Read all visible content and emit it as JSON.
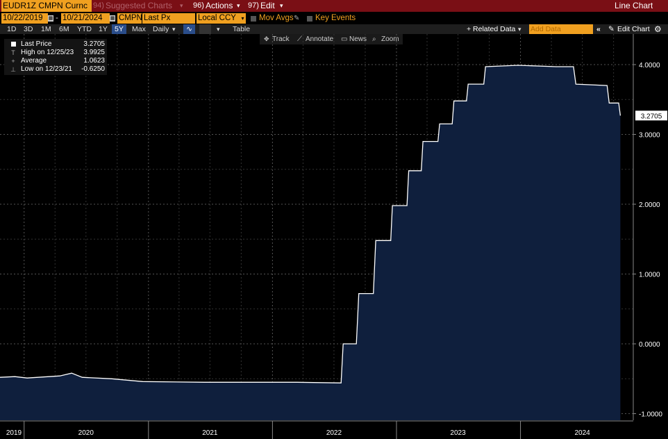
{
  "header": {
    "ticker": "EUDR1Z CMPN Curnc",
    "suggested_num": "94)",
    "suggested": "Suggested Charts",
    "actions_num": "96)",
    "actions": "Actions",
    "edit_num": "97)",
    "edit": "Edit",
    "chart_type": "Line Chart"
  },
  "controls": {
    "start_date": "10/22/2019",
    "end_date": "10/21/2024",
    "source": "CMPN",
    "field": "Last Px",
    "currency": "Local CCY",
    "mov_avgs": "Mov Avgs",
    "key_events": "Key Events"
  },
  "periods": [
    "1D",
    "3D",
    "1M",
    "6M",
    "YTD",
    "1Y",
    "5Y",
    "Max"
  ],
  "selected_period": "5Y",
  "frequency": "Daily",
  "table_label": "Table",
  "related_data": "+ Related Data",
  "add_data_placeholder": "Add Data",
  "edit_chart": "Edit Chart",
  "tools": {
    "track": "Track",
    "annotate": "Annotate",
    "news": "News",
    "zoom": "Zoom"
  },
  "legend": {
    "last_label": "Last Price",
    "last_value": "3.2705",
    "high_label": "High on 12/25/23",
    "high_value": "3.9925",
    "avg_label": "Average",
    "avg_value": "1.0623",
    "low_label": "Low on 12/23/21",
    "low_value": "-0.6250"
  },
  "colors": {
    "area_fill": "#0f1f3d",
    "line": "#ffffff",
    "header_bg": "#7a0f15",
    "accent": "#f0a020",
    "grid": "#555555"
  },
  "icons": [
    "gear-icon",
    "chevron-double-left-icon",
    "pencil-icon",
    "line-chart-icon",
    "dropdown-icon"
  ],
  "chart_data": {
    "type": "area",
    "title": "",
    "xlabel": "",
    "ylabel": "",
    "ylim": [
      -1.0,
      4.2
    ],
    "y_ticks": [
      "-1.0000",
      "0.0000",
      "1.0000",
      "2.0000",
      "3.0000",
      "4.0000"
    ],
    "y_tick_values": [
      -1.0,
      0.0,
      1.0,
      2.0,
      3.0,
      4.0
    ],
    "x_ticks": [
      "2019",
      "2020",
      "2021",
      "2022",
      "2023",
      "2024"
    ],
    "x_tick_dates": [
      "2019-12-01",
      "2020-07-01",
      "2021-07-01",
      "2022-07-01",
      "2023-07-01",
      "2024-07-01"
    ],
    "year_boundaries": [
      "2020-01-01",
      "2021-01-01",
      "2022-01-01",
      "2023-01-01",
      "2024-01-01"
    ],
    "grid": true,
    "last_value_label": "3.2705",
    "series": [
      {
        "points": [
          [
            "2019-10-22",
            -0.48
          ],
          [
            "2019-12-05",
            -0.47
          ],
          [
            "2020-01-10",
            -0.49
          ],
          [
            "2020-04-15",
            -0.46
          ],
          [
            "2020-05-20",
            -0.42
          ],
          [
            "2020-06-20",
            -0.48
          ],
          [
            "2020-09-15",
            -0.5
          ],
          [
            "2020-12-15",
            -0.54
          ],
          [
            "2021-06-15",
            -0.55
          ],
          [
            "2021-12-23",
            -0.55
          ],
          [
            "2022-03-15",
            -0.55
          ],
          [
            "2022-07-22",
            -0.56
          ],
          [
            "2022-07-28",
            0.0
          ],
          [
            "2022-09-05",
            0.0
          ],
          [
            "2022-09-12",
            0.72
          ],
          [
            "2022-10-25",
            0.72
          ],
          [
            "2022-11-01",
            1.48
          ],
          [
            "2022-12-15",
            1.48
          ],
          [
            "2022-12-20",
            1.98
          ],
          [
            "2023-02-01",
            1.98
          ],
          [
            "2023-02-06",
            2.48
          ],
          [
            "2023-03-15",
            2.48
          ],
          [
            "2023-03-20",
            2.9
          ],
          [
            "2023-05-03",
            2.9
          ],
          [
            "2023-05-08",
            3.15
          ],
          [
            "2023-06-14",
            3.15
          ],
          [
            "2023-06-19",
            3.48
          ],
          [
            "2023-07-26",
            3.48
          ],
          [
            "2023-07-31",
            3.72
          ],
          [
            "2023-09-15",
            3.72
          ],
          [
            "2023-09-20",
            3.97
          ],
          [
            "2023-12-25",
            3.99
          ],
          [
            "2024-04-15",
            3.97
          ],
          [
            "2024-06-05",
            3.97
          ],
          [
            "2024-06-12",
            3.72
          ],
          [
            "2024-09-12",
            3.7
          ],
          [
            "2024-09-18",
            3.45
          ],
          [
            "2024-10-16",
            3.45
          ],
          [
            "2024-10-21",
            3.27
          ]
        ]
      }
    ]
  }
}
